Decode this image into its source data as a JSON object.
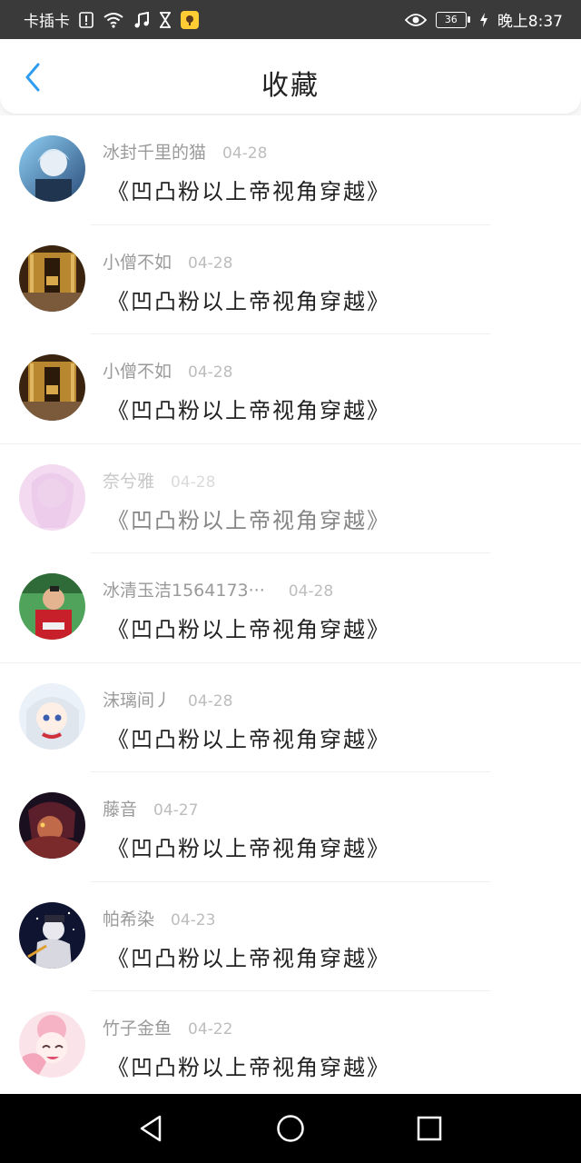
{
  "status_bar": {
    "carrier": "卡插卡",
    "time": "晚上8:37",
    "battery": "36",
    "icons": [
      "sim-alert-icon",
      "wifi-icon",
      "music-icon",
      "hourglass-icon",
      "app-notification-icon",
      "eye-icon",
      "charging-icon"
    ]
  },
  "header": {
    "title": "收藏",
    "back_icon": "chevron-left-icon",
    "accent": "#2f9cf0"
  },
  "favorites": [
    {
      "user": "冰封千里的猫",
      "date": "04-28",
      "book": "《凹凸粉以上帝视角穿越》"
    },
    {
      "user": "小僧不如",
      "date": "04-28",
      "book": "《凹凸粉以上帝视角穿越》"
    },
    {
      "user": "小僧不如",
      "date": "04-28",
      "book": "《凹凸粉以上帝视角穿越》"
    },
    {
      "user": "奈兮雅",
      "date": "04-28",
      "book": "《凹凸粉以上帝视角穿越》"
    },
    {
      "user": "冰清玉洁1564173···",
      "date": "04-28",
      "book": "《凹凸粉以上帝视角穿越》"
    },
    {
      "user": "沫璃间丿",
      "date": "04-28",
      "book": "《凹凸粉以上帝视角穿越》"
    },
    {
      "user": "藤音",
      "date": "04-27",
      "book": "《凹凸粉以上帝视角穿越》"
    },
    {
      "user": "帕希染",
      "date": "04-23",
      "book": "《凹凸粉以上帝视角穿越》"
    },
    {
      "user": "竹子金鱼",
      "date": "04-22",
      "book": "《凹凸粉以上帝视角穿越》"
    }
  ],
  "nav_bar": {
    "icons": [
      "back-triangle-icon",
      "home-circle-icon",
      "recents-square-icon"
    ]
  }
}
